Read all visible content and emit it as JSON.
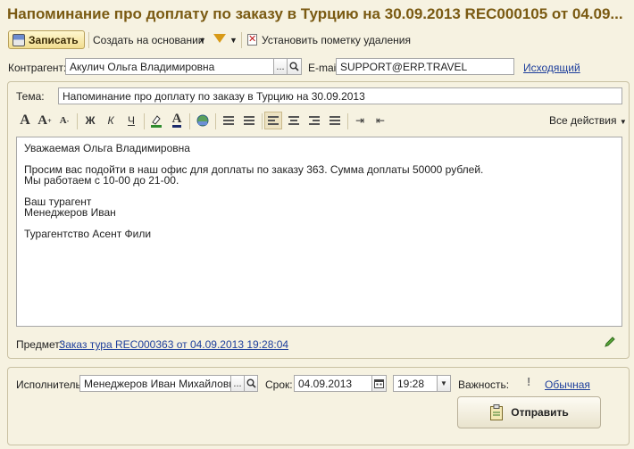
{
  "window": {
    "title": "Напоминание про доплату по заказу в Турцию на 30.09.2013 REC000105 от 04.09..."
  },
  "toolbar": {
    "save_label": "Записать",
    "create_based_label": "Создать на основании",
    "mark_delete_label": "Установить пометку удаления"
  },
  "header": {
    "counterparty_label": "Контрагент:",
    "counterparty_value": "Акулич Ольга Владимировна",
    "email_label": "E-mail:",
    "email_value": "SUPPORT@ERP.TRAVEL",
    "direction_link": "Исходящий"
  },
  "message": {
    "subject_label": "Тема:",
    "subject_value": "Напоминание про доплату по заказу в Турцию на 30.09.2013",
    "all_actions_label": "Все действия",
    "body_lines": [
      "Уважаемая Ольга Владимировна",
      "",
      "Просим вас подойти в наш офис для доплаты по заказу 363. Сумма доплаты 50000 рублей.",
      "Мы работаем с 10-00 до 21-00.",
      "",
      "Ваш турагент",
      "Менеджеров Иван",
      "",
      "Турагентство Асент Фили"
    ],
    "subject_item_label": "Предмет:",
    "subject_item_link": "Заказ тура REC000363 от 04.09.2013 19:28:04"
  },
  "footer": {
    "executor_label": "Исполнитель:",
    "executor_value": "Менеджеров Иван Михайлович",
    "deadline_label": "Срок:",
    "deadline_date": "04.09.2013",
    "deadline_time": "19:28",
    "importance_label": "Важность:",
    "importance_value": "Обычная",
    "send_label": "Отправить"
  }
}
